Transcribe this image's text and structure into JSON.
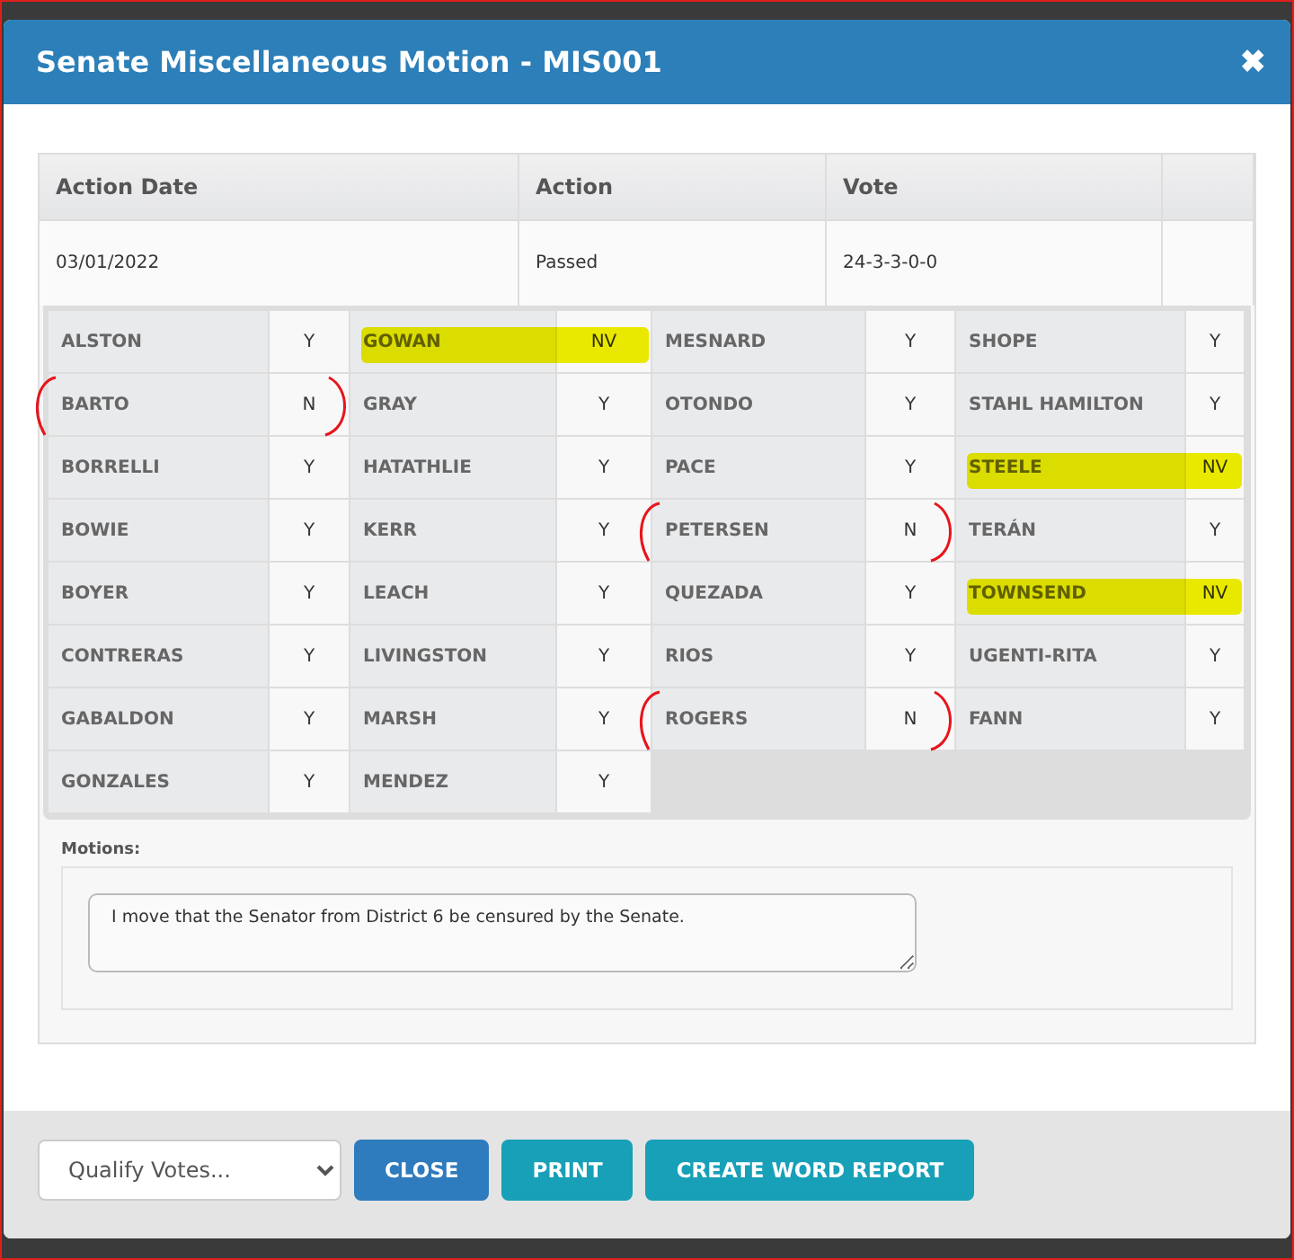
{
  "dialog": {
    "title": "Senate Miscellaneous Motion - MIS001",
    "close_icon": "✖"
  },
  "actions_table": {
    "columns": [
      "Action Date",
      "Action",
      "Vote"
    ],
    "rows": [
      {
        "action_date": "03/01/2022",
        "action": "Passed",
        "vote": "24-3-3-0-0"
      }
    ]
  },
  "vote_grid": [
    [
      {
        "name": "ALSTON",
        "vote": "Y",
        "highlighted": false,
        "circled": false
      },
      {
        "name": "BARTO",
        "vote": "N",
        "highlighted": false,
        "circled": true
      },
      {
        "name": "BORRELLI",
        "vote": "Y",
        "highlighted": false,
        "circled": false
      },
      {
        "name": "BOWIE",
        "vote": "Y",
        "highlighted": false,
        "circled": false
      },
      {
        "name": "BOYER",
        "vote": "Y",
        "highlighted": false,
        "circled": false
      },
      {
        "name": "CONTRERAS",
        "vote": "Y",
        "highlighted": false,
        "circled": false
      },
      {
        "name": "GABALDON",
        "vote": "Y",
        "highlighted": false,
        "circled": false
      },
      {
        "name": "GONZALES",
        "vote": "Y",
        "highlighted": false,
        "circled": false
      }
    ],
    [
      {
        "name": "GOWAN",
        "vote": "NV",
        "highlighted": true,
        "circled": false
      },
      {
        "name": "GRAY",
        "vote": "Y",
        "highlighted": false,
        "circled": false
      },
      {
        "name": "HATATHLIE",
        "vote": "Y",
        "highlighted": false,
        "circled": false
      },
      {
        "name": "KERR",
        "vote": "Y",
        "highlighted": false,
        "circled": false
      },
      {
        "name": "LEACH",
        "vote": "Y",
        "highlighted": false,
        "circled": false
      },
      {
        "name": "LIVINGSTON",
        "vote": "Y",
        "highlighted": false,
        "circled": false
      },
      {
        "name": "MARSH",
        "vote": "Y",
        "highlighted": false,
        "circled": false
      },
      {
        "name": "MENDEZ",
        "vote": "Y",
        "highlighted": false,
        "circled": false
      }
    ],
    [
      {
        "name": "MESNARD",
        "vote": "Y",
        "highlighted": false,
        "circled": false
      },
      {
        "name": "OTONDO",
        "vote": "Y",
        "highlighted": false,
        "circled": false
      },
      {
        "name": "PACE",
        "vote": "Y",
        "highlighted": false,
        "circled": false
      },
      {
        "name": "PETERSEN",
        "vote": "N",
        "highlighted": false,
        "circled": true
      },
      {
        "name": "QUEZADA",
        "vote": "Y",
        "highlighted": false,
        "circled": false
      },
      {
        "name": "RIOS",
        "vote": "Y",
        "highlighted": false,
        "circled": false
      },
      {
        "name": "ROGERS",
        "vote": "N",
        "highlighted": false,
        "circled": true
      }
    ],
    [
      {
        "name": "SHOPE",
        "vote": "Y",
        "highlighted": false,
        "circled": false
      },
      {
        "name": "STAHL HAMILTON",
        "vote": "Y",
        "highlighted": false,
        "circled": false
      },
      {
        "name": "STEELE",
        "vote": "NV",
        "highlighted": true,
        "circled": false
      },
      {
        "name": "TERÁN",
        "vote": "Y",
        "highlighted": false,
        "circled": false
      },
      {
        "name": "TOWNSEND",
        "vote": "NV",
        "highlighted": true,
        "circled": false
      },
      {
        "name": "UGENTI-RITA",
        "vote": "Y",
        "highlighted": false,
        "circled": false
      },
      {
        "name": "FANN",
        "vote": "Y",
        "highlighted": false,
        "circled": false
      }
    ]
  ],
  "motions": {
    "label": "Motions:",
    "text": "I move that the Senator from District 6 be censured by the Senate."
  },
  "footer": {
    "qualify_select": {
      "value": "Qualify Votes..."
    },
    "buttons": [
      {
        "label": "CLOSE",
        "kind": "primary"
      },
      {
        "label": "PRINT",
        "kind": "info"
      },
      {
        "label": "CREATE WORD REPORT",
        "kind": "info"
      }
    ]
  }
}
